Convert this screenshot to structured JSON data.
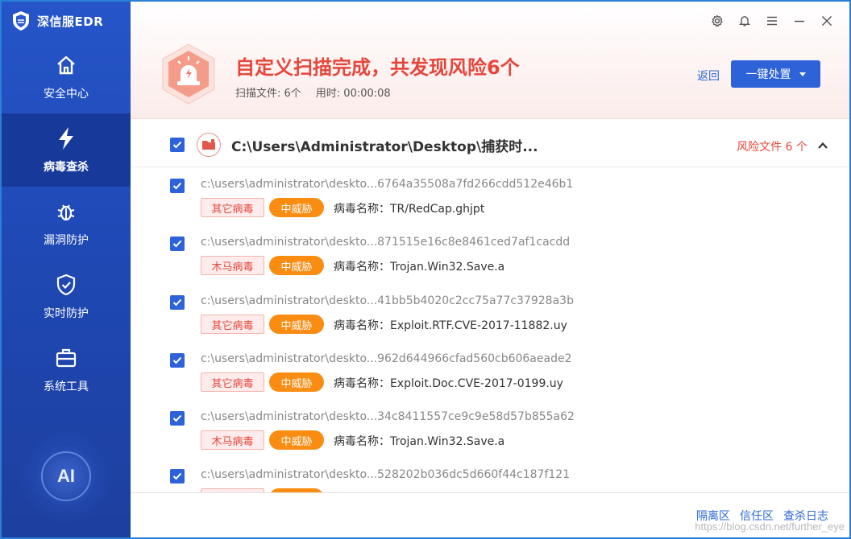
{
  "app": {
    "title": "深信服EDR"
  },
  "sidebar": {
    "items": [
      {
        "label": "安全中心",
        "icon": "home-icon",
        "active": false
      },
      {
        "label": "病毒查杀",
        "icon": "lightning-icon",
        "active": true
      },
      {
        "label": "漏洞防护",
        "icon": "bug-icon",
        "active": false
      },
      {
        "label": "实时防护",
        "icon": "shield-check-icon",
        "active": false
      },
      {
        "label": "系统工具",
        "icon": "toolbox-icon",
        "active": false
      }
    ],
    "ai_label": "AI"
  },
  "header": {
    "title": "自定义扫描完成，共发现风险6个",
    "scanned_files": "扫描文件: 6个",
    "elapsed": "用时: 00:00:08",
    "back_label": "返回",
    "handle_label": "一键处置"
  },
  "group": {
    "path": "C:\\Users\\Administrator\\Desktop\\捕获时...",
    "risk_count": "风险文件 6 个"
  },
  "items": [
    {
      "path": "c:\\users\\administrator\\deskto...6764a35508a7fd266cdd512e46b1",
      "type": "其它病毒",
      "level": "中威胁",
      "virus": "病毒名称：TR/RedCap.ghjpt"
    },
    {
      "path": "c:\\users\\administrator\\deskto...871515e16c8e8461ced7af1cacdd",
      "type": "木马病毒",
      "level": "中威胁",
      "virus": "病毒名称：Trojan.Win32.Save.a"
    },
    {
      "path": "c:\\users\\administrator\\deskto...41bb5b4020c2cc75a77c37928a3b",
      "type": "其它病毒",
      "level": "中威胁",
      "virus": "病毒名称：Exploit.RTF.CVE-2017-11882.uy"
    },
    {
      "path": "c:\\users\\administrator\\deskto...962d644966cfad560cb606aeade2",
      "type": "其它病毒",
      "level": "中威胁",
      "virus": "病毒名称：Exploit.Doc.CVE-2017-0199.uy"
    },
    {
      "path": "c:\\users\\administrator\\deskto...34c8411557ce9c9e58d57b855a62",
      "type": "木马病毒",
      "level": "中威胁",
      "virus": "病毒名称：Trojan.Win32.Save.a"
    },
    {
      "path": "c:\\users\\administrator\\deskto...528202b036dc5d660f44c187f121",
      "type": "",
      "level": "",
      "virus": ""
    }
  ],
  "footer": {
    "quarantine": "隔离区",
    "trust": "信任区",
    "log": "查杀日志"
  },
  "watermark": "https://blog.csdn.net/further_eye",
  "colors": {
    "accent": "#2d62d8",
    "danger": "#e6463b",
    "warning": "#fb8c12",
    "sidebar": "#1f49b5"
  }
}
